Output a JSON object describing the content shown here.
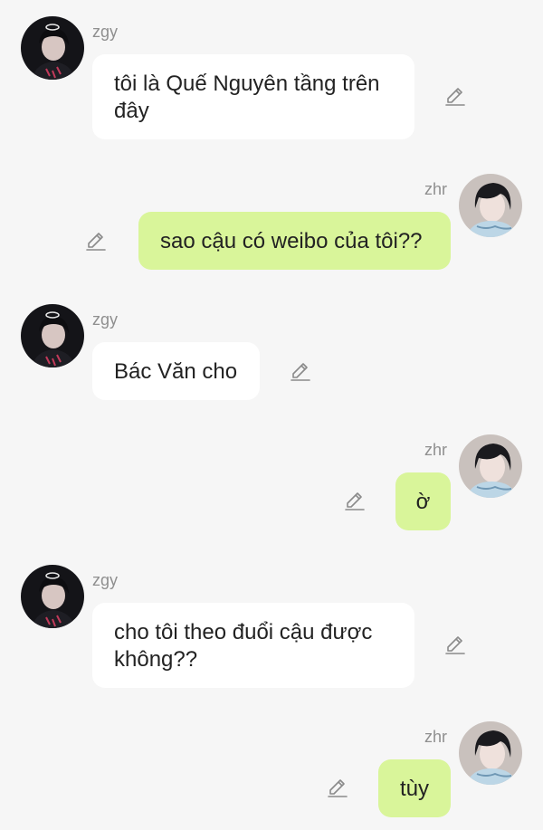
{
  "colors": {
    "background": "#f6f6f6",
    "incoming_bubble": "#ffffff",
    "outgoing_bubble": "#d9f59a",
    "name_text": "#8f8f8f",
    "message_text": "#222222",
    "edit_icon": "#8a8a8a"
  },
  "messages": [
    {
      "sender": "zgy",
      "direction": "incoming",
      "text": "tôi là Quế Nguyên tầng trên đây",
      "avatar": "avatar-zgy",
      "edit_icon": "pencil-icon"
    },
    {
      "sender": "zhr",
      "direction": "outgoing",
      "text": "sao cậu có weibo của tôi??",
      "avatar": "avatar-zhr",
      "edit_icon": "pencil-icon"
    },
    {
      "sender": "zgy",
      "direction": "incoming",
      "text": "Bác Văn cho",
      "avatar": "avatar-zgy",
      "edit_icon": "pencil-icon"
    },
    {
      "sender": "zhr",
      "direction": "outgoing",
      "text": "ờ",
      "avatar": "avatar-zhr",
      "edit_icon": "pencil-icon"
    },
    {
      "sender": "zgy",
      "direction": "incoming",
      "text": "cho tôi theo đuổi cậu được không??",
      "avatar": "avatar-zgy",
      "edit_icon": "pencil-icon"
    },
    {
      "sender": "zhr",
      "direction": "outgoing",
      "text": "tùy",
      "avatar": "avatar-zhr",
      "edit_icon": "pencil-icon"
    }
  ]
}
